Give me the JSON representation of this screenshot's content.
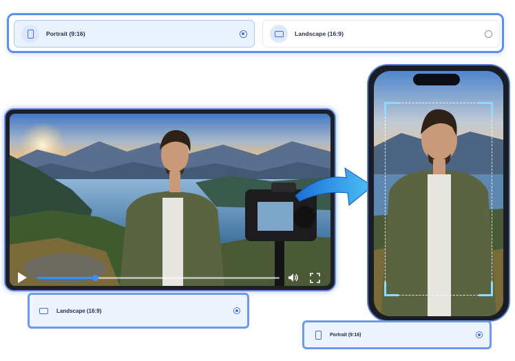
{
  "orientation_selector": {
    "options": [
      {
        "label": "Portrait (9:16)",
        "selected": true,
        "icon": "portrait-icon"
      },
      {
        "label": "Landscape (16:9)",
        "selected": false,
        "icon": "landscape-icon"
      }
    ]
  },
  "landscape_card": {
    "label": "Landscape (16:9)",
    "selected": true
  },
  "portrait_card": {
    "label": "Portrait (9:16)",
    "selected": true
  },
  "player": {
    "progress": 0.24
  },
  "colors": {
    "accent": "#3b6fd6",
    "border": "#5a8ff0",
    "selected_bg": "#eaf2fe",
    "arrow": "#3aa7f0"
  }
}
